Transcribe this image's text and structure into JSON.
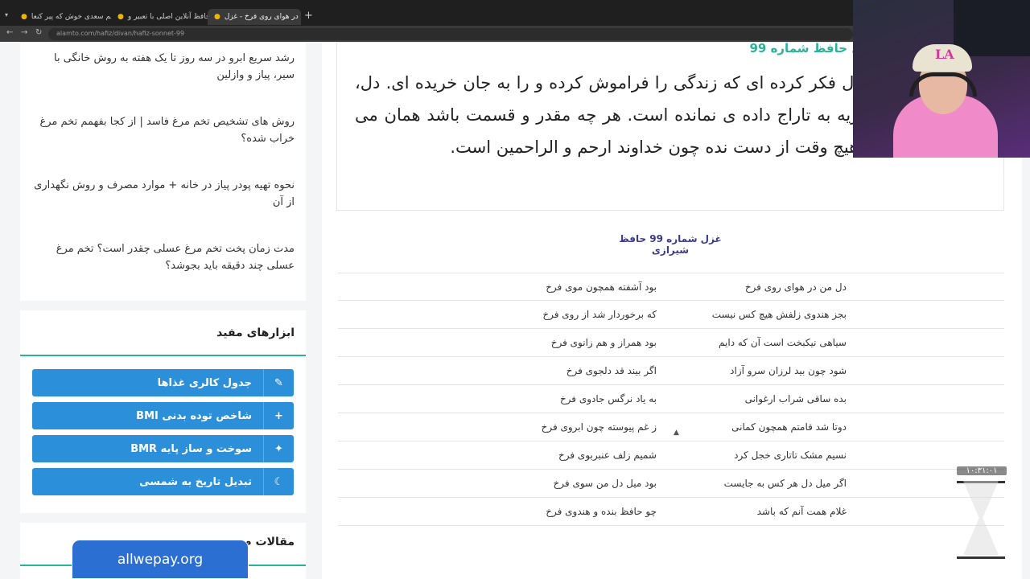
{
  "browser": {
    "tabs": [
      {
        "title": "شنیدم‌هم سعدی خوش که پیر کنعا"
      },
      {
        "title": "فال حافظ آنلاین اصلی با تعبیر و"
      },
      {
        "title": "دل من در هوای روی فرخ - غزل"
      }
    ],
    "new_tab": "+",
    "url": "alamto.com/hafiz/divan/hafiz-sonnet-99"
  },
  "sidebar": {
    "links": [
      "رشد سریع ابرو در سه روز تا یک هفته به روش خانگی با سیر، پیاز و وازلین",
      "روش های تشخیص تخم مرغ فاسد | از کجا بفهمم تخم مرغ خراب شده؟",
      "نحوه تهیه پودر پیاز در خانه + موارد مصرف و روش نگهداری از آن",
      "مدت زمان پخت تخم مرغ عسلی چقدر است؟ تخم مرغ عسلی چند دقیقه باید بجوشد؟"
    ],
    "tools_title": "ابزارهای مفید",
    "tools": [
      {
        "label": "جدول کالری غذاها",
        "icon": "pencil-icon",
        "glyph": "✎"
      },
      {
        "label": "شاخص توده بدنی BMI",
        "icon": "plus-icon",
        "glyph": "+"
      },
      {
        "label": "سوخت و ساز پایه BMR",
        "icon": "sparkle-icon",
        "glyph": "✦"
      },
      {
        "label": "تبدیل تاریخ به شمسی",
        "icon": "moon-icon",
        "glyph": "☾"
      }
    ],
    "articles_title": "مقالات م"
  },
  "main": {
    "quote_heading": "ما؛ غزل حافظ شماره 99",
    "quote_text": "هوای یار به وصال فکر کرده ای که زندگی را فراموش کرده و را به جان خریده ای. دل، دیده ات را با گریه به تاراج داده ی نمانده است. هر چه مقدر و قسمت باشد همان می شود. امیدت را هیچ وقت از دست نده چون خداوند ارحم و الراحمین است.",
    "poem_title": "غزل شماره 99 حافظ شیرازی",
    "verses": [
      {
        "r": "دل من در هوای روی فرخ",
        "l": "بود آشفته همچون موی فرخ"
      },
      {
        "r": "بجز هندوی زلفش هیچ کس نیست",
        "l": "که برخوردار شد از روی فرخ"
      },
      {
        "r": "سیاهی نیکبخت است آن که دایم",
        "l": "بود همراز و هم زانوی فرخ"
      },
      {
        "r": "شود چون بید لرزان سرو آزاد",
        "l": "اگر بیند قد دلجوی فرخ"
      },
      {
        "r": "بده ساقی شراب ارغوانی",
        "l": "به یاد نرگس جادوی فرخ"
      },
      {
        "r": "دوتا شد قامتم همچون کمانی",
        "l": "ز غم پیوسته چون ابروی فرخ"
      },
      {
        "r": "نسیم مشک تاتاری خجل کرد",
        "l": "شمیم زلف عنبربوی فرخ"
      },
      {
        "r": "اگر میل دل هر کس به جایست",
        "l": "بود میل دل من سوی فرخ"
      },
      {
        "r": "غلام همت آنم که باشد",
        "l": "چو حافظ بنده و هندوی فرخ"
      }
    ]
  },
  "overlay": {
    "timer": "۱۰:۳۱:۰۱",
    "watermark": "allwepay.org",
    "cap_logo": "LA"
  }
}
